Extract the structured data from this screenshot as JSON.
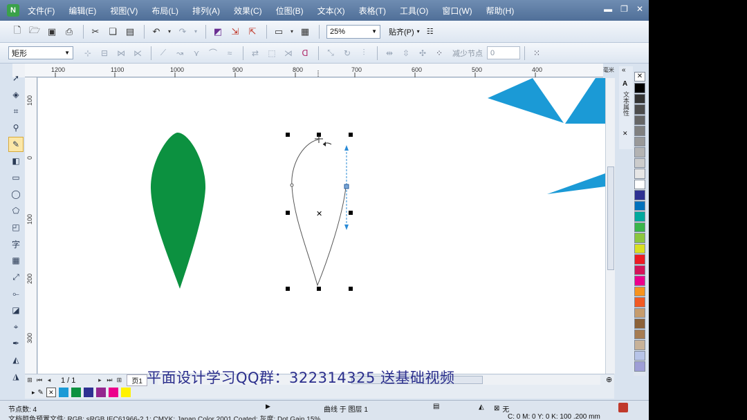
{
  "menu": {
    "items": [
      "文件(F)",
      "编辑(E)",
      "视图(V)",
      "布局(L)",
      "排列(A)",
      "效果(C)",
      "位图(B)",
      "文本(X)",
      "表格(T)",
      "工具(O)",
      "窗口(W)",
      "帮助(H)"
    ],
    "app_icon": "N"
  },
  "toolbar": {
    "zoom_value": "25%",
    "snap_label": "贴齐(P)"
  },
  "propbar": {
    "object_type": "矩形",
    "reduce_nodes_label": "减少节点",
    "reduce_nodes_value": "0"
  },
  "ruler": {
    "h_ticks": [
      "1200",
      "1100",
      "1000",
      "900",
      "800",
      "700",
      "600",
      "500",
      "400"
    ],
    "v_ticks": [
      "100",
      "0",
      "100",
      "200",
      "300"
    ],
    "unit": "毫米"
  },
  "pagenav": {
    "page_count": "1 / 1",
    "page_tab": "页1"
  },
  "status": {
    "nodes": "节点数: 4",
    "layer": "曲线 于 图层 1",
    "profile": "文档颜色预置文件: RGB: sRGB IEC61966-2.1; CMYK: Japan Color 2001 Coated; 灰度: Dot Gain 15%",
    "fill_none": "无",
    "cmyk": "C: 0 M: 0 Y: 0 K: 100 .200 mm"
  },
  "banner": "平面设计学习QQ群：322314325 送基础视频",
  "docker_title": "文本属性",
  "colors": {
    "leaf_green": "#0c9140",
    "triangle_blue": "#1b9ad6",
    "menubar": "#5b7ba4"
  },
  "palette": [
    "#000000",
    "#333333",
    "#4d4d4d",
    "#666666",
    "#808080",
    "#999999",
    "#b3b3b3",
    "#cccccc",
    "#e6e6e6",
    "#ffffff",
    "#2e3192",
    "#0071bc",
    "#00a99d",
    "#39b54a",
    "#8cc63f",
    "#d9e021",
    "#ed1c24",
    "#d4145a",
    "#ec008c",
    "#f7931e",
    "#f15a24",
    "#c69c6d",
    "#8c6239",
    "#a67c52",
    "#c7b299",
    "#b7c4e8",
    "#9e9ed6"
  ],
  "doc_palette": [
    "#1b9ad6",
    "#0c9140",
    "#2e3192",
    "#93278f",
    "#ec008c",
    "#fff200"
  ]
}
